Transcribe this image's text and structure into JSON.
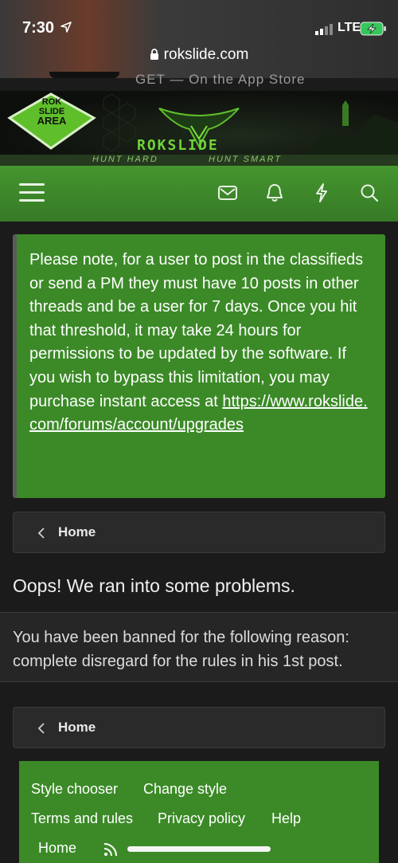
{
  "status_bar": {
    "time": "7:30",
    "network": "LTE"
  },
  "browser": {
    "url": "rokslide.com"
  },
  "app_banner": {
    "text": "GET — On the App Store"
  },
  "site_banner": {
    "logo_text": [
      "ROK",
      "SLIDE",
      "AREA"
    ],
    "brand": "ROKSLIDE",
    "tagline_left": "HUNT HARD",
    "tagline_right": "HUNT SMART"
  },
  "nav": {
    "icons": [
      "menu-icon",
      "envelope-icon",
      "bell-icon",
      "bolt-icon",
      "search-icon"
    ]
  },
  "notice": {
    "text": "Please note, for a user to post in the classifieds or send a PM they must have 10 posts in other threads and be a user for 7 days. Once you hit that threshold, it may take 24 hours for permissions to be updated by the software. If you wish to bypass this limitation, you may purchase instant access at ",
    "link": "https://www.rokslide.com/forums/account/upgrades"
  },
  "breadcrumb": {
    "label": "Home"
  },
  "error": {
    "title": "Oops! We ran into some problems.",
    "message": "You have been banned for the following reason: complete disregard for the rules in his 1st post."
  },
  "footer": {
    "style_chooser": "Style chooser",
    "change_style": "Change style",
    "terms": "Terms and rules",
    "privacy": "Privacy policy",
    "help": "Help",
    "home": "Home"
  },
  "colors": {
    "accent_green": "#3b8a27",
    "nav_green": "#3d8a2c",
    "background": "#1b1b1b"
  }
}
